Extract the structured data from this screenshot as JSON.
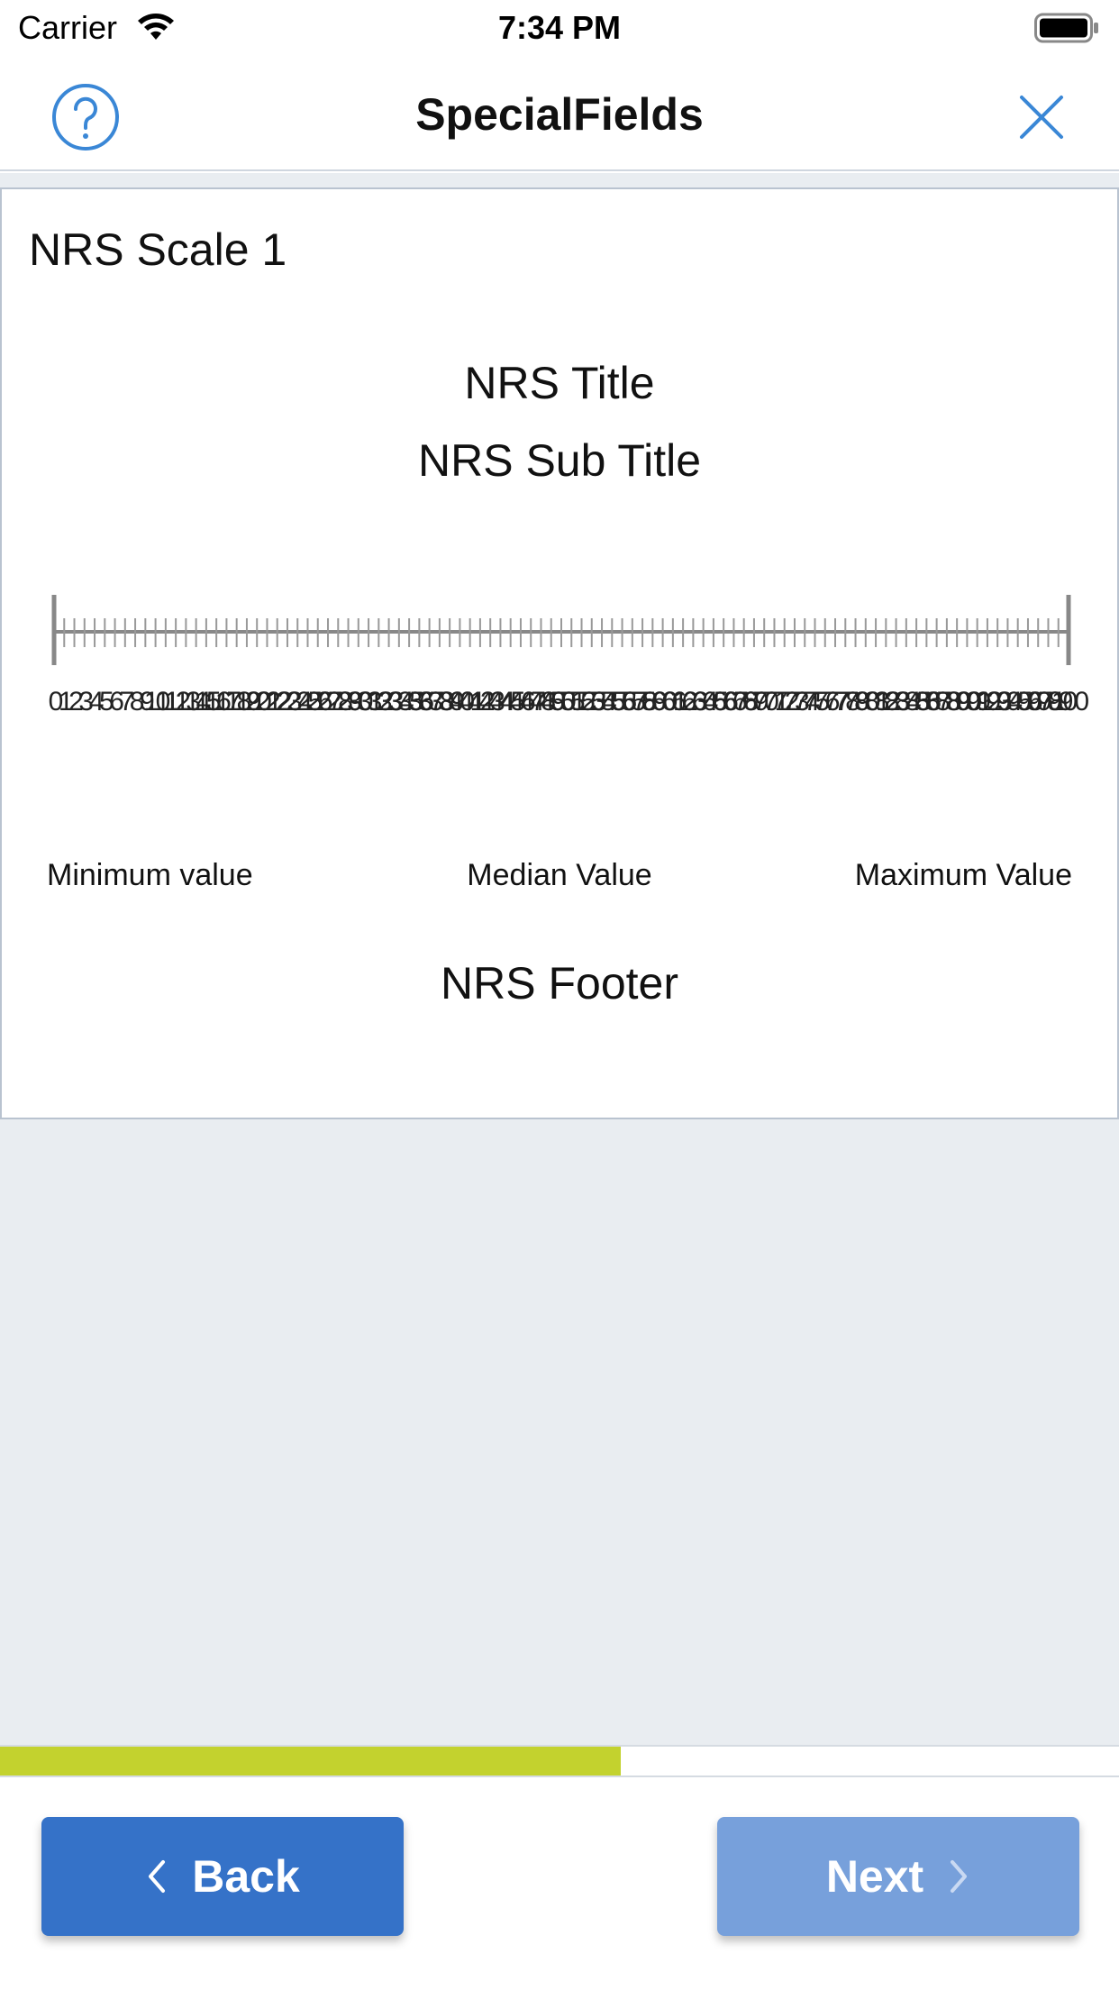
{
  "status_bar": {
    "carrier": "Carrier",
    "time": "7:34 PM"
  },
  "nav": {
    "title": "SpecialFields",
    "help_icon": "question-circle-icon",
    "close_icon": "close-icon",
    "accent_color": "#3a87d6"
  },
  "card": {
    "heading": "NRS Scale 1",
    "title": "NRS Title",
    "subtitle": "NRS Sub Title",
    "scale": {
      "min": 0,
      "max": 100,
      "step": 1,
      "tick_labels": [
        "0",
        "1",
        "2",
        "3",
        "4",
        "5",
        "6",
        "7",
        "8",
        "9",
        "10",
        "11",
        "12",
        "13",
        "14",
        "15",
        "16",
        "17",
        "18",
        "19",
        "20",
        "21",
        "22",
        "23",
        "24",
        "25",
        "26",
        "27",
        "28",
        "29",
        "30",
        "31",
        "32",
        "33",
        "34",
        "35",
        "36",
        "37",
        "38",
        "39",
        "40",
        "41",
        "42",
        "43",
        "44",
        "45",
        "46",
        "47",
        "48",
        "49",
        "50",
        "51",
        "52",
        "53",
        "54",
        "55",
        "56",
        "57",
        "58",
        "59",
        "60",
        "61",
        "62",
        "63",
        "64",
        "65",
        "66",
        "67",
        "68",
        "69",
        "70",
        "71",
        "72",
        "73",
        "74",
        "75",
        "76",
        "77",
        "78",
        "79",
        "80",
        "81",
        "82",
        "83",
        "84",
        "85",
        "86",
        "87",
        "88",
        "89",
        "90",
        "91",
        "92",
        "93",
        "94",
        "95",
        "96",
        "97",
        "98",
        "99",
        "100"
      ]
    },
    "min_label": "Minimum value",
    "median_label": "Median Value",
    "max_label": "Maximum Value",
    "footer": "NRS Footer"
  },
  "progress": {
    "fraction": 0.555,
    "color": "#c3d22e"
  },
  "buttons": {
    "back_label": "Back",
    "next_label": "Next",
    "back_icon": "chevron-left-icon",
    "next_icon": "chevron-right-icon",
    "back_color": "#3572c8",
    "next_color": "#77a0db"
  }
}
